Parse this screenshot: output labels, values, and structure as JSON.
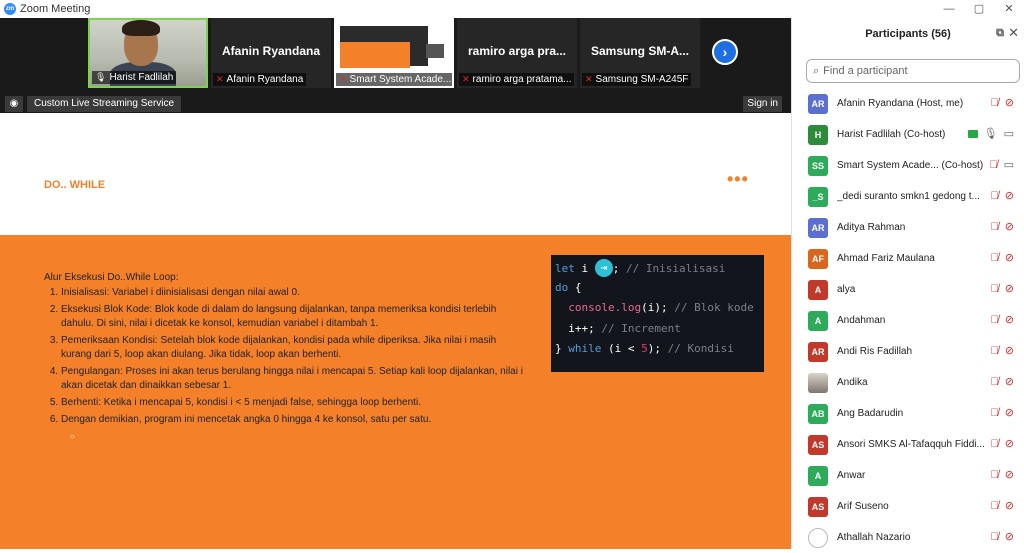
{
  "window": {
    "title": "Zoom Meeting",
    "logo_text": "zm",
    "controls": [
      "—",
      "▢",
      "✕"
    ]
  },
  "filmstrip": {
    "tiles": [
      {
        "label": "Harist Fadlilah",
        "type": "video",
        "active": true,
        "mic": "on"
      },
      {
        "center_name": "Afanin Ryandana",
        "label": "Afanin Ryandana",
        "type": "name",
        "mic": "off"
      },
      {
        "label": "Smart System Acade...",
        "type": "screen",
        "mic": "off"
      },
      {
        "center_name": "ramiro arga pra...",
        "label": "ramiro arga pratama...",
        "type": "name",
        "mic": "off"
      },
      {
        "center_name": "Samsung SM-A...",
        "label": "Samsung SM-A245F",
        "type": "name",
        "mic": "off"
      }
    ],
    "next_icon": "chevron-right-icon"
  },
  "toolbar": {
    "stream_label": "Custom Live Streaming Service",
    "signin_label": "Sign in"
  },
  "slide": {
    "title": "DO.. WHILE",
    "menu_dots": "•••",
    "intro": "Alur Eksekusi Do..While Loop:",
    "steps": [
      "Inisialisasi: Variabel i diinisialisasi dengan nilai awal 0.",
      "Eksekusi Blok Kode: Blok kode di dalam do langsung dijalankan, tanpa memeriksa kondisi terlebih dahulu. Di sini, nilai i dicetak ke konsol, kemudian variabel i ditambah 1.",
      "Pemeriksaan Kondisi: Setelah blok kode dijalankan, kondisi pada while diperiksa. Jika nilai i masih kurang dari 5, loop akan diulang. Jika tidak, loop akan berhenti.",
      "Pengulangan: Proses ini akan terus berulang hingga nilai i mencapai 5. Setiap kali loop dijalankan, nilai i akan dicetak dan dinaikkan sebesar 1.",
      "Berhenti: Ketika i mencapai 5, kondisi i < 5 menjadi false, sehingga loop berhenti.",
      "Dengan demikian, program ini mencetak angka 0 hingga 4 ke konsol, satu per satu."
    ],
    "sub_bullet": "○",
    "code": {
      "line1": {
        "kw": "let",
        "var": " i ",
        "rest": "; ",
        "comment": "// Inisialisasi"
      },
      "line2": {
        "kw": "do",
        "rest": " {"
      },
      "line3": {
        "fn": "console.log",
        "rest": "(i); ",
        "comment": "// Blok kode"
      },
      "line4": {
        "rest": "i++; ",
        "comment": "// Increment"
      },
      "line5": {
        "rest1": "} ",
        "kw": "while",
        "rest2": " (i < ",
        "num": "5",
        "rest3": "); ",
        "comment": "// Kondisi"
      }
    }
  },
  "participants": {
    "title": "Participants (56)",
    "search_placeholder": "Find a participant",
    "list": [
      {
        "initials": "AR",
        "color": "#5b6fd1",
        "name": "Afanin Ryandana (Host, me)",
        "mic": "muted",
        "cam": "off"
      },
      {
        "initials": "H",
        "color": "#2e8b3a",
        "name": "Harist Fadlilah (Co-host)",
        "mic": "on",
        "cam": "on",
        "sharing": true
      },
      {
        "initials": "SS",
        "color": "#2eab5a",
        "name": "Smart System Acade...  (Co-host)",
        "mic": "muted",
        "cam": "on"
      },
      {
        "initials": "_S",
        "color": "#2eab5a",
        "name": "_dedi suranto smkn1 gedong t...",
        "mic": "muted",
        "cam": "off"
      },
      {
        "initials": "AR",
        "color": "#5b6fd1",
        "name": "Aditya Rahman",
        "mic": "muted",
        "cam": "off"
      },
      {
        "initials": "AF",
        "color": "#d9661f",
        "name": "Ahmad Fariz Maulana",
        "mic": "muted",
        "cam": "off"
      },
      {
        "initials": "A",
        "color": "#c0392b",
        "name": "alya",
        "mic": "muted",
        "cam": "off"
      },
      {
        "initials": "A",
        "color": "#2eab5a",
        "name": "Andahman",
        "mic": "muted",
        "cam": "off"
      },
      {
        "initials": "AR",
        "color": "#c0392b",
        "name": "Andi Ris Fadillah",
        "mic": "muted",
        "cam": "off"
      },
      {
        "initials": "",
        "color": "#b0a89e",
        "name": "Andika",
        "mic": "muted",
        "cam": "off",
        "photo": true
      },
      {
        "initials": "AB",
        "color": "#2eab5a",
        "name": "Ang Badarudin",
        "mic": "muted",
        "cam": "off"
      },
      {
        "initials": "AS",
        "color": "#c0392b",
        "name": "Ansori SMKS Al-Tafaqquh Fiddi...",
        "mic": "muted",
        "cam": "off"
      },
      {
        "initials": "A",
        "color": "#2eab5a",
        "name": "Anwar",
        "mic": "muted",
        "cam": "off"
      },
      {
        "initials": "AS",
        "color": "#c0392b",
        "name": "Arif Suseno",
        "mic": "muted",
        "cam": "off"
      },
      {
        "initials": "",
        "color": "#ffffff",
        "name": "Athallah Nazario",
        "mic": "muted",
        "cam": "off",
        "outline": true
      }
    ]
  }
}
